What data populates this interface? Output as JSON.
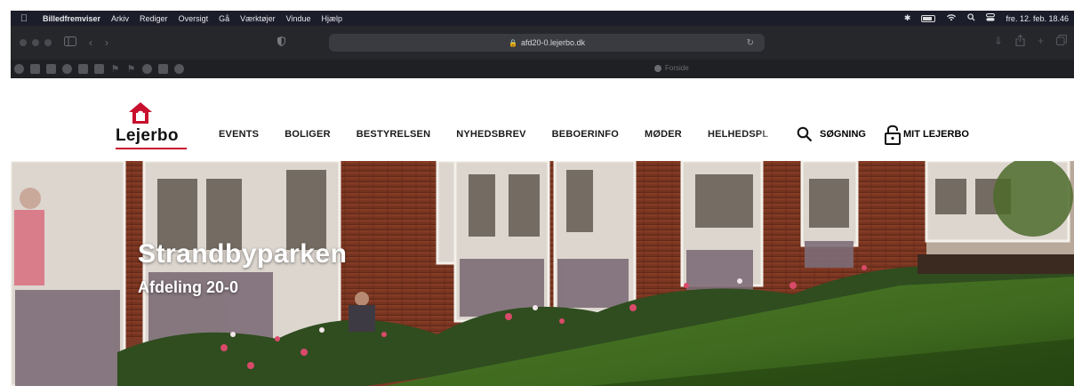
{
  "menubar": {
    "app_name": "Billedfremviser",
    "items": [
      "Arkiv",
      "Rediger",
      "Oversigt",
      "Gå",
      "Værktøjer",
      "Vindue",
      "Hjælp"
    ],
    "datetime": "fre. 12. feb. 18.46"
  },
  "browser": {
    "url": "afd20-0.lejerbo.dk",
    "tab_title": "Forside"
  },
  "site": {
    "logo_text": "Lejerbo",
    "nav": [
      "EVENTS",
      "BOLIGER",
      "BESTYRELSEN",
      "NYHEDSBREV",
      "BEBOERINFO",
      "MØDER",
      "HELHEDSPL"
    ],
    "search_label": "SØGNING",
    "login_label": "MIT LEJERBO"
  },
  "hero": {
    "title": "Strandbyparken",
    "subtitle": "Afdeling 20-0"
  },
  "colors": {
    "brand_red": "#c8102e",
    "menubar_bg": "#1c1d2a",
    "toolbar_bg": "#26272b"
  }
}
